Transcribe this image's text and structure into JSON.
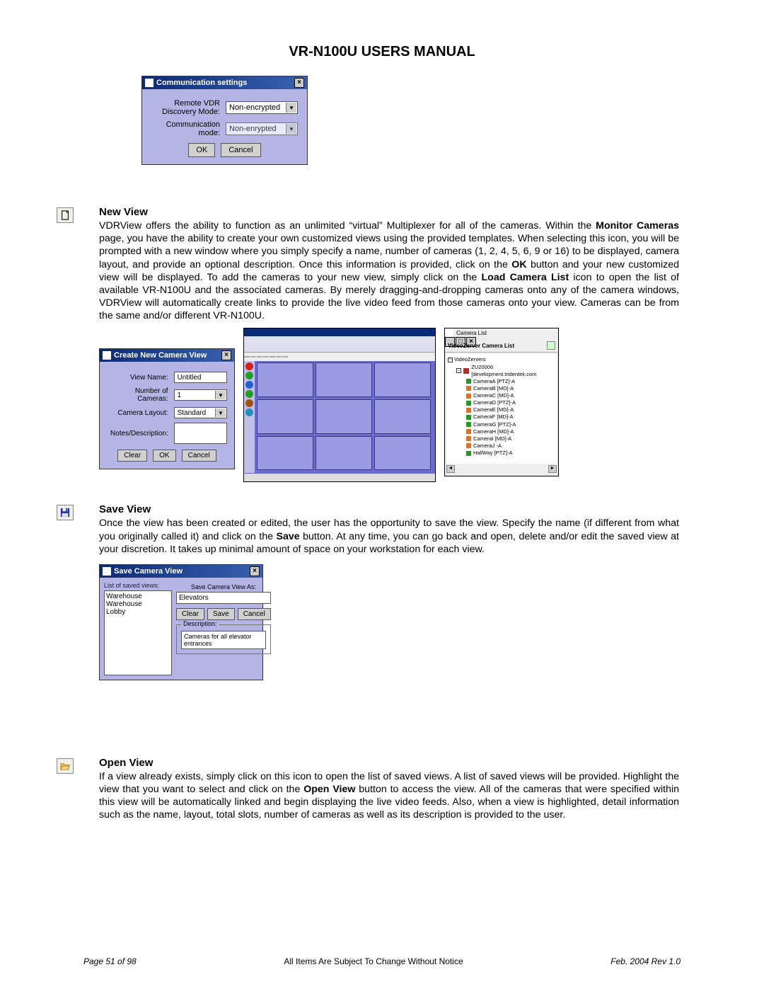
{
  "page_title": "VR-N100U USERS MANUAL",
  "comm_settings": {
    "title": "Communication settings",
    "row1_label": "Remote VDR Discovery Mode:",
    "row1_value": "Non-encrypted",
    "row2_label": "Communication mode:",
    "row2_value": "Non-enrypted",
    "ok": "OK",
    "cancel": "Cancel"
  },
  "new_view": {
    "heading": "New View",
    "para_a": "VDRView offers the ability to function as an unlimited “virtual” Multiplexer for all of the cameras. Within the ",
    "bold_a": "Monitor Cameras",
    "para_b": " page, you have the ability to create your own customized views using the provided templates. When selecting this icon, you will be prompted with a new window where you simply specify a name, number of cameras (1, 2, 4, 5, 6, 9 or 16) to be displayed, camera layout, and provide an optional description. Once this information is provided, click on the ",
    "bold_b": "OK",
    "para_c": " button and your new customized view will be displayed. To add the cameras to your new view, simply click on the ",
    "bold_c": "Load Camera List",
    "para_d": " icon to open the list of available VR-N100U and the associated cameras. By merely dragging-and-dropping cameras onto any of the camera windows, VDRView will automatically create links to provide the live video feed from those cameras onto your view. Cameras can be from the same and/or different VR-N100U."
  },
  "create_view": {
    "title": "Create New Camera View",
    "view_name_label": "View Name:",
    "view_name_value": "Untitled",
    "num_cams_label": "Number of Cameras:",
    "num_cams_value": "1",
    "layout_label": "Camera Layout:",
    "layout_value": "Standard",
    "notes_label": "Notes/Description:",
    "clear": "Clear",
    "ok": "OK",
    "cancel": "Cancel"
  },
  "camera_list": {
    "title": "Camera List",
    "header": "VideoZerver Camera List",
    "root": "VideoZervers",
    "server": "ZU20006 [development.tridentek.com",
    "cameras": [
      {
        "label": "CameraA [PTZ]-A",
        "c": "g"
      },
      {
        "label": "CameraB [MD]-A",
        "c": "o"
      },
      {
        "label": "CameraC [MD]-A",
        "c": "o"
      },
      {
        "label": "CameraD [PTZ]-A",
        "c": "g"
      },
      {
        "label": "CameraE [MD]-A",
        "c": "o"
      },
      {
        "label": "CameraF [MD]-A",
        "c": "g"
      },
      {
        "label": "CameraG [PTZ]-A",
        "c": "g"
      },
      {
        "label": "CameraH [MD]-A",
        "c": "o"
      },
      {
        "label": "CameraI [MD]-A",
        "c": "o"
      },
      {
        "label": "CameraJ -A",
        "c": "o"
      },
      {
        "label": "HallWay [PTZ]-A",
        "c": "g"
      }
    ]
  },
  "save_view": {
    "heading": "Save View",
    "para_a": "Once the view has been created or edited, the user has the opportunity to save the view. Specify the name (if different from what you originally called it) and click on the ",
    "bold_a": "Save",
    "para_b": " button. At any time, you can go back and open, delete and/or edit the saved view at your discretion. It takes up minimal amount of space on your workstation for each view.",
    "title": "Save Camera View",
    "list_title": "List of saved views:",
    "list_items": [
      "Warehouse",
      "Warehouse",
      "Lobby"
    ],
    "save_as_label": "Save Camera View As:",
    "input_value": "Elevators",
    "clear": "Clear",
    "save": "Save",
    "cancel": "Cancel",
    "desc_label": "Description:",
    "desc_value": "Cameras for all elevator entrances"
  },
  "open_view": {
    "heading": "Open View",
    "para_a": "If a view already exists, simply click on this icon to open the list of saved views. A list of saved views will be provided. Highlight the view that you want to select and click on the ",
    "bold_a": "Open View",
    "para_b": " button to access the view. All of the cameras that were specified within this view will be automatically linked and begin displaying the live video feeds. Also, when a view is highlighted, detail information such as the name, layout, total slots, number of cameras as well as its description is provided to the user."
  },
  "footer": {
    "left": "Page 51 of 98",
    "center": "All Items Are Subject To Change Without Notice",
    "right": "Feb. 2004 Rev 1.0"
  }
}
